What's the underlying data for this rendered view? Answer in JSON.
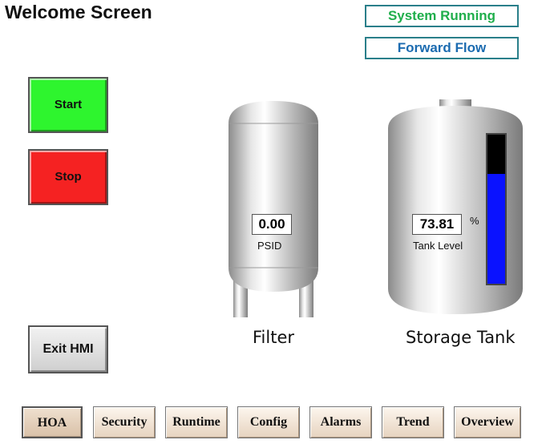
{
  "header": {
    "title": "Welcome Screen"
  },
  "status": {
    "running": "System Running",
    "flow": "Forward Flow"
  },
  "controls": {
    "start_label": "Start",
    "stop_label": "Stop",
    "exit_label": "Exit HMI"
  },
  "filter": {
    "value": "0.00",
    "unit_label": "PSID",
    "name": "Filter"
  },
  "tank": {
    "value": "73.81",
    "percent_symbol": "%",
    "value_label": "Tank Level",
    "name": "Storage Tank",
    "level_percent": 73.81
  },
  "colors": {
    "start": "#2ef52e",
    "stop": "#f52222",
    "running_text": "#1fae4b",
    "flow_text": "#1b6bb0",
    "level_fill": "#0a12ff"
  },
  "nav": {
    "items": [
      {
        "label": "HOA"
      },
      {
        "label": "Security"
      },
      {
        "label": "Runtime"
      },
      {
        "label": "Config"
      },
      {
        "label": "Alarms"
      },
      {
        "label": "Trend"
      },
      {
        "label": "Overview"
      }
    ]
  }
}
